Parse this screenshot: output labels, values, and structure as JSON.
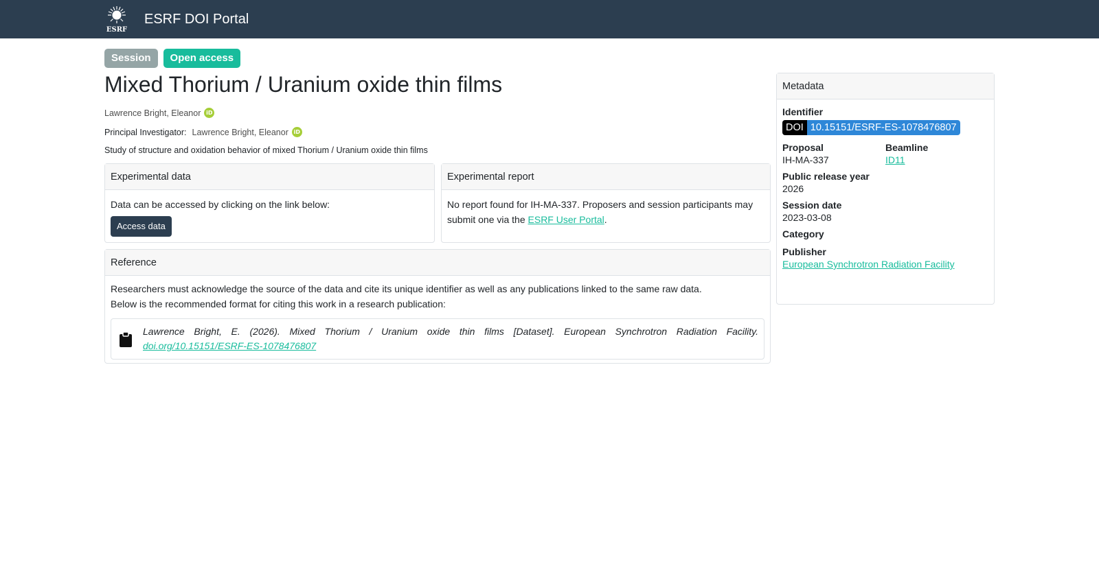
{
  "header": {
    "brand": "ESRF DOI Portal",
    "logo_text": "ESRF"
  },
  "badges": {
    "session": "Session",
    "access": "Open access"
  },
  "main": {
    "title": "Mixed Thorium / Uranium oxide thin films",
    "author": "Lawrence Bright, Eleanor",
    "pi_label": "Principal Investigator:",
    "pi_name": "Lawrence Bright, Eleanor",
    "abstract": "Study of structure and oxidation behavior of mixed Thorium / Uranium oxide thin films"
  },
  "experimental_data": {
    "header": "Experimental data",
    "text": "Data can be accessed by clicking on the link below:",
    "button": "Access data"
  },
  "experimental_report": {
    "header": "Experimental report",
    "text_before": "No report found for IH-MA-337. Proposers and session participants may submit one via the ",
    "link": "ESRF User Portal",
    "text_after": "."
  },
  "reference": {
    "header": "Reference",
    "line1": "Researchers must acknowledge the source of the data and cite its unique identifier as well as any publications linked to the same raw data.",
    "line2": "Below is the recommended format for citing this work in a research publication:",
    "citation": "Lawrence Bright, E. (2026). Mixed Thorium / Uranium oxide thin films [Dataset]. European Synchrotron Radiation Facility. ",
    "citation_link": "doi.org/10.15151/ESRF-ES-1078476807"
  },
  "metadata": {
    "header": "Metadata",
    "identifier_label": "Identifier",
    "doi_key": "DOI",
    "doi_value": "10.15151/ESRF-ES-1078476807",
    "proposal_label": "Proposal",
    "proposal_value": "IH-MA-337",
    "beamline_label": "Beamline",
    "beamline_value": "ID11",
    "release_label": "Public release year",
    "release_value": "2026",
    "session_date_label": "Session date",
    "session_date_value": "2023-03-08",
    "category_label": "Category",
    "publisher_label": "Publisher",
    "publisher_value": "European Synchrotron Radiation Facility"
  },
  "icons": {
    "orcid": "orcid-icon",
    "clipboard": "clipboard-icon",
    "logo": "esrf-logo"
  },
  "colors": {
    "navbar": "#2c3e50",
    "accent": "#18bc9c",
    "session_badge": "#95a5a6",
    "doi_blue": "#2e87d8",
    "orcid_green": "#a6ce39"
  }
}
